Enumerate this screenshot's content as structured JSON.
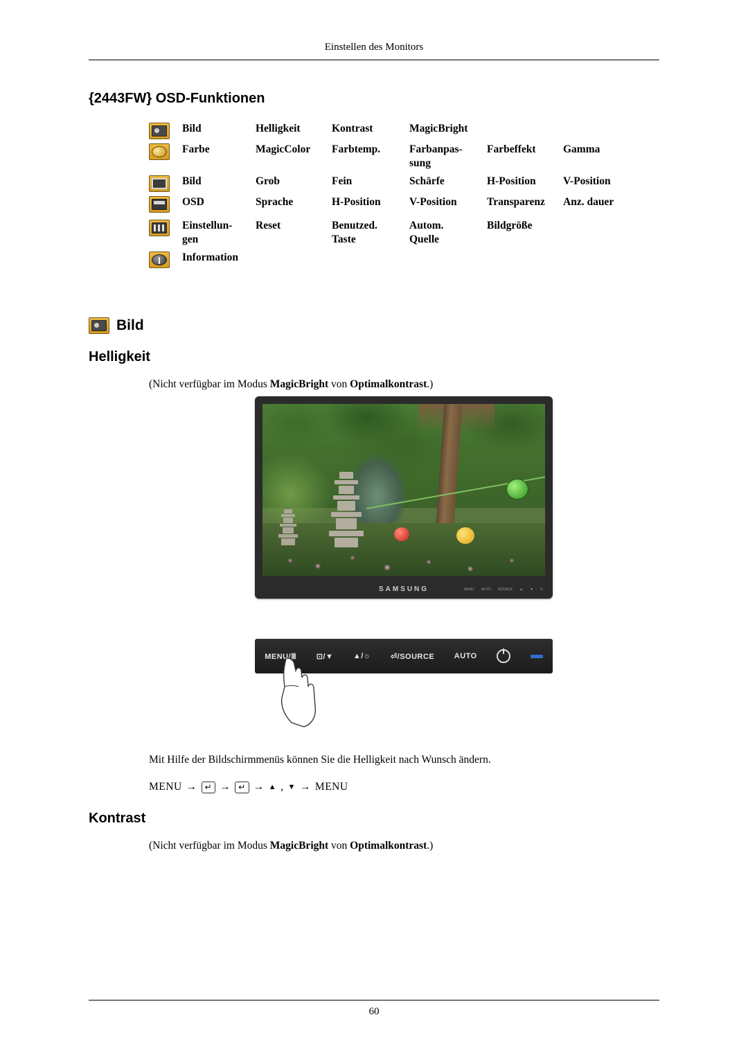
{
  "header": {
    "running_title": "Einstellen des Monitors",
    "page_number": "60"
  },
  "title": "{2443FW} OSD-Funktionen",
  "osd_table": {
    "rows": [
      {
        "icon": "picture-icon",
        "cells": [
          "Bild",
          "Helligkeit",
          "Kontrast",
          "MagicBright",
          "",
          ""
        ]
      },
      {
        "icon": "color-icon",
        "cells": [
          "Farbe",
          "MagicColor",
          "Farbtemp.",
          "Farbanpas-\nsung",
          "Farbeffekt",
          "Gamma"
        ]
      },
      {
        "icon": "picture-adjust-icon",
        "cells": [
          "Bild",
          "Grob",
          "Fein",
          "Schärfe",
          "H-Position",
          "V-Position"
        ]
      },
      {
        "icon": "osd-icon",
        "cells": [
          "OSD",
          "Sprache",
          "H-Position",
          "V-Position",
          "Transparenz",
          "Anz. dauer"
        ]
      },
      {
        "icon": "setup-icon",
        "cells": [
          "Einstellun-\ngen",
          "Reset",
          "Benutzed.\nTaste",
          "Autom.\nQuelle",
          "Bildgröße",
          ""
        ]
      },
      {
        "icon": "information-icon",
        "cells": [
          "Information",
          "",
          "",
          "",
          "",
          ""
        ]
      }
    ]
  },
  "sections": {
    "bild_label": "Bild",
    "helligkeit_heading": "Helligkeit",
    "helligkeit_note_prefix": "(Nicht verfügbar im Modus ",
    "helligkeit_note_bold1": "MagicBright",
    "helligkeit_note_mid": " von ",
    "helligkeit_note_bold2": "Optimalkontrast",
    "helligkeit_note_suffix": ".)",
    "body_text": "Mit Hilfe der Bildschirmmenüs können Sie die Helligkeit nach Wunsch ändern.",
    "menu_sequence": {
      "start": "MENU",
      "arrow": "→",
      "enter_key": "↵",
      "up": "▲",
      "comma": ",",
      "down": "▼",
      "end": "MENU"
    },
    "kontrast_heading": "Kontrast",
    "kontrast_note_prefix": "(Nicht verfügbar im Modus ",
    "kontrast_note_bold1": "MagicBright",
    "kontrast_note_mid": " von ",
    "kontrast_note_bold2": "Optimalkontrast",
    "kontrast_note_suffix": ".)"
  },
  "monitor_image": {
    "brand": "SAMSUNG",
    "bezel_keys": [
      "MENU",
      "AUTO",
      "SOURCE",
      "▲",
      "▼",
      "⏻"
    ]
  },
  "control_panel": {
    "buttons": [
      "MENU/Ⅲ",
      "⊡/▼",
      "▲/☼",
      "⏎/SOURCE",
      "AUTO"
    ]
  }
}
